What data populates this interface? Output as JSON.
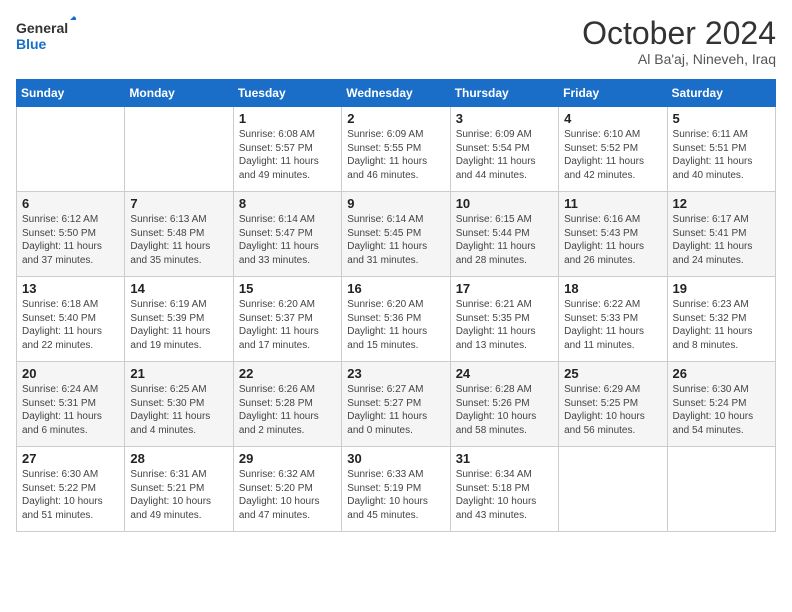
{
  "header": {
    "logo_line1": "General",
    "logo_line2": "Blue",
    "month": "October 2024",
    "location": "Al Ba'aj, Nineveh, Iraq"
  },
  "weekdays": [
    "Sunday",
    "Monday",
    "Tuesday",
    "Wednesday",
    "Thursday",
    "Friday",
    "Saturday"
  ],
  "weeks": [
    [
      {
        "day": "",
        "sunrise": "",
        "sunset": "",
        "daylight": ""
      },
      {
        "day": "",
        "sunrise": "",
        "sunset": "",
        "daylight": ""
      },
      {
        "day": "1",
        "sunrise": "Sunrise: 6:08 AM",
        "sunset": "Sunset: 5:57 PM",
        "daylight": "Daylight: 11 hours and 49 minutes."
      },
      {
        "day": "2",
        "sunrise": "Sunrise: 6:09 AM",
        "sunset": "Sunset: 5:55 PM",
        "daylight": "Daylight: 11 hours and 46 minutes."
      },
      {
        "day": "3",
        "sunrise": "Sunrise: 6:09 AM",
        "sunset": "Sunset: 5:54 PM",
        "daylight": "Daylight: 11 hours and 44 minutes."
      },
      {
        "day": "4",
        "sunrise": "Sunrise: 6:10 AM",
        "sunset": "Sunset: 5:52 PM",
        "daylight": "Daylight: 11 hours and 42 minutes."
      },
      {
        "day": "5",
        "sunrise": "Sunrise: 6:11 AM",
        "sunset": "Sunset: 5:51 PM",
        "daylight": "Daylight: 11 hours and 40 minutes."
      }
    ],
    [
      {
        "day": "6",
        "sunrise": "Sunrise: 6:12 AM",
        "sunset": "Sunset: 5:50 PM",
        "daylight": "Daylight: 11 hours and 37 minutes."
      },
      {
        "day": "7",
        "sunrise": "Sunrise: 6:13 AM",
        "sunset": "Sunset: 5:48 PM",
        "daylight": "Daylight: 11 hours and 35 minutes."
      },
      {
        "day": "8",
        "sunrise": "Sunrise: 6:14 AM",
        "sunset": "Sunset: 5:47 PM",
        "daylight": "Daylight: 11 hours and 33 minutes."
      },
      {
        "day": "9",
        "sunrise": "Sunrise: 6:14 AM",
        "sunset": "Sunset: 5:45 PM",
        "daylight": "Daylight: 11 hours and 31 minutes."
      },
      {
        "day": "10",
        "sunrise": "Sunrise: 6:15 AM",
        "sunset": "Sunset: 5:44 PM",
        "daylight": "Daylight: 11 hours and 28 minutes."
      },
      {
        "day": "11",
        "sunrise": "Sunrise: 6:16 AM",
        "sunset": "Sunset: 5:43 PM",
        "daylight": "Daylight: 11 hours and 26 minutes."
      },
      {
        "day": "12",
        "sunrise": "Sunrise: 6:17 AM",
        "sunset": "Sunset: 5:41 PM",
        "daylight": "Daylight: 11 hours and 24 minutes."
      }
    ],
    [
      {
        "day": "13",
        "sunrise": "Sunrise: 6:18 AM",
        "sunset": "Sunset: 5:40 PM",
        "daylight": "Daylight: 11 hours and 22 minutes."
      },
      {
        "day": "14",
        "sunrise": "Sunrise: 6:19 AM",
        "sunset": "Sunset: 5:39 PM",
        "daylight": "Daylight: 11 hours and 19 minutes."
      },
      {
        "day": "15",
        "sunrise": "Sunrise: 6:20 AM",
        "sunset": "Sunset: 5:37 PM",
        "daylight": "Daylight: 11 hours and 17 minutes."
      },
      {
        "day": "16",
        "sunrise": "Sunrise: 6:20 AM",
        "sunset": "Sunset: 5:36 PM",
        "daylight": "Daylight: 11 hours and 15 minutes."
      },
      {
        "day": "17",
        "sunrise": "Sunrise: 6:21 AM",
        "sunset": "Sunset: 5:35 PM",
        "daylight": "Daylight: 11 hours and 13 minutes."
      },
      {
        "day": "18",
        "sunrise": "Sunrise: 6:22 AM",
        "sunset": "Sunset: 5:33 PM",
        "daylight": "Daylight: 11 hours and 11 minutes."
      },
      {
        "day": "19",
        "sunrise": "Sunrise: 6:23 AM",
        "sunset": "Sunset: 5:32 PM",
        "daylight": "Daylight: 11 hours and 8 minutes."
      }
    ],
    [
      {
        "day": "20",
        "sunrise": "Sunrise: 6:24 AM",
        "sunset": "Sunset: 5:31 PM",
        "daylight": "Daylight: 11 hours and 6 minutes."
      },
      {
        "day": "21",
        "sunrise": "Sunrise: 6:25 AM",
        "sunset": "Sunset: 5:30 PM",
        "daylight": "Daylight: 11 hours and 4 minutes."
      },
      {
        "day": "22",
        "sunrise": "Sunrise: 6:26 AM",
        "sunset": "Sunset: 5:28 PM",
        "daylight": "Daylight: 11 hours and 2 minutes."
      },
      {
        "day": "23",
        "sunrise": "Sunrise: 6:27 AM",
        "sunset": "Sunset: 5:27 PM",
        "daylight": "Daylight: 11 hours and 0 minutes."
      },
      {
        "day": "24",
        "sunrise": "Sunrise: 6:28 AM",
        "sunset": "Sunset: 5:26 PM",
        "daylight": "Daylight: 10 hours and 58 minutes."
      },
      {
        "day": "25",
        "sunrise": "Sunrise: 6:29 AM",
        "sunset": "Sunset: 5:25 PM",
        "daylight": "Daylight: 10 hours and 56 minutes."
      },
      {
        "day": "26",
        "sunrise": "Sunrise: 6:30 AM",
        "sunset": "Sunset: 5:24 PM",
        "daylight": "Daylight: 10 hours and 54 minutes."
      }
    ],
    [
      {
        "day": "27",
        "sunrise": "Sunrise: 6:30 AM",
        "sunset": "Sunset: 5:22 PM",
        "daylight": "Daylight: 10 hours and 51 minutes."
      },
      {
        "day": "28",
        "sunrise": "Sunrise: 6:31 AM",
        "sunset": "Sunset: 5:21 PM",
        "daylight": "Daylight: 10 hours and 49 minutes."
      },
      {
        "day": "29",
        "sunrise": "Sunrise: 6:32 AM",
        "sunset": "Sunset: 5:20 PM",
        "daylight": "Daylight: 10 hours and 47 minutes."
      },
      {
        "day": "30",
        "sunrise": "Sunrise: 6:33 AM",
        "sunset": "Sunset: 5:19 PM",
        "daylight": "Daylight: 10 hours and 45 minutes."
      },
      {
        "day": "31",
        "sunrise": "Sunrise: 6:34 AM",
        "sunset": "Sunset: 5:18 PM",
        "daylight": "Daylight: 10 hours and 43 minutes."
      },
      {
        "day": "",
        "sunrise": "",
        "sunset": "",
        "daylight": ""
      },
      {
        "day": "",
        "sunrise": "",
        "sunset": "",
        "daylight": ""
      }
    ]
  ]
}
